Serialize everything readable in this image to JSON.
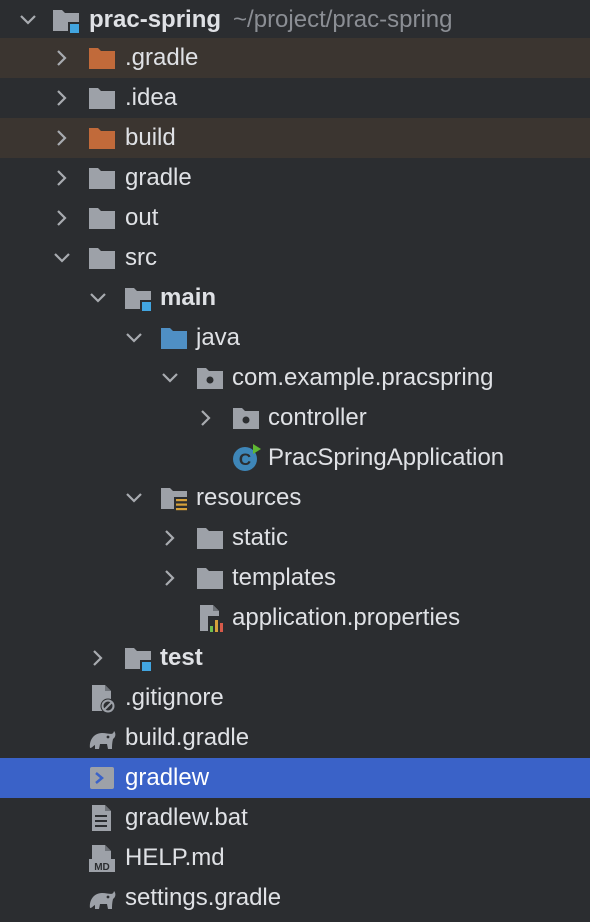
{
  "project": {
    "name": "prac-spring",
    "path": "~/project/prac-spring"
  },
  "items": {
    "gradle_dir": ".gradle",
    "idea_dir": ".idea",
    "build_dir": "build",
    "gradle_wrapper_dir": "gradle",
    "out_dir": "out",
    "src_dir": "src",
    "main_dir": "main",
    "java_dir": "java",
    "package": "com.example.pracspring",
    "controller_pkg": "controller",
    "app_class": "PracSpringApplication",
    "resources_dir": "resources",
    "static_dir": "static",
    "templates_dir": "templates",
    "app_properties": "application.properties",
    "test_dir": "test",
    "gitignore": ".gitignore",
    "build_gradle": "build.gradle",
    "gradlew": "gradlew",
    "gradlew_bat": "gradlew.bat",
    "help_md": "HELP.md",
    "settings_gradle": "settings.gradle"
  },
  "colors": {
    "background": "#2b2d30",
    "selection": "#3a62c8",
    "excluded_row": "#3b3530",
    "folder_gray": "#9da1a8",
    "folder_orange": "#c16a3a",
    "folder_blue": "#4f8fc4",
    "accent_blue": "#42a5e0"
  }
}
